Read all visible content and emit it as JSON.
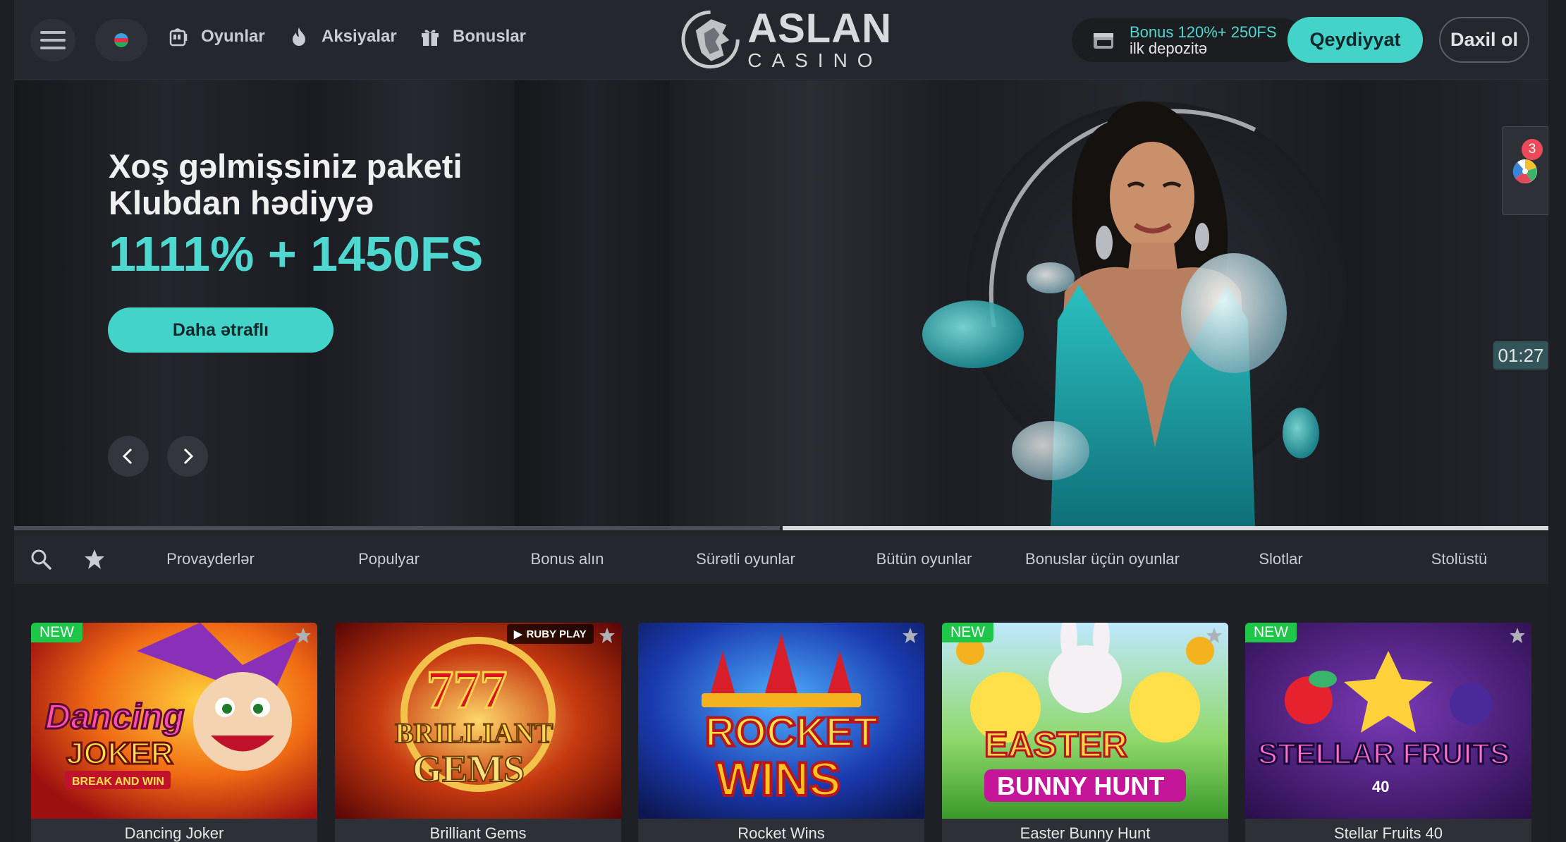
{
  "header": {
    "nav": [
      {
        "label": "Oyunlar",
        "icon": "slot-machine-icon"
      },
      {
        "label": "Aksiyalar",
        "icon": "flame-icon"
      },
      {
        "label": "Bonuslar",
        "icon": "gift-icon"
      }
    ],
    "logo": {
      "top": "ASLAN",
      "bottom": "CASINO"
    },
    "bonus": {
      "line1": "Bonus 120%+ 250FS",
      "line2": "ilk depozitə"
    },
    "register_label": "Qeydiyyat",
    "login_label": "Daxil ol"
  },
  "hero": {
    "title_line1": "Xoş gəlmişsiniz paketi",
    "title_line2": "Klubdan hədiyyə",
    "amount": "1111% + 1450FS",
    "button_label": "Daha ətraflı",
    "timer": "01:27",
    "widget_count": "3"
  },
  "categories": [
    "Provayderlər",
    "Populyar",
    "Bonus alın",
    "Sürətli oyunlar",
    "Bütün oyunlar",
    "Bonuslar üçün oyunlar",
    "Slotlar",
    "Stolüstü"
  ],
  "games": [
    {
      "title": "Dancing Joker",
      "badge": "NEW",
      "art_text1": "Dancing",
      "art_text2": "JOKER",
      "art_text3": "BREAK AND WIN"
    },
    {
      "title": "Brilliant Gems",
      "provider": "RUBY PLAY",
      "art_text1": "777",
      "art_text2": "BRILLIANT",
      "art_text3": "GEMS"
    },
    {
      "title": "Rocket Wins",
      "art_text1": "ROCKET",
      "art_text2": "WINS"
    },
    {
      "title": "Easter Bunny Hunt",
      "badge": "NEW",
      "art_text1": "EASTER",
      "art_text2": "BUNNY HUNT"
    },
    {
      "title": "Stellar Fruits 40",
      "badge": "NEW",
      "art_text1": "STELLAR FRUITS",
      "art_text2": "40"
    }
  ],
  "colors": {
    "accent": "#43d3c9",
    "new_badge": "#1fc64a",
    "background": "#23252b"
  }
}
